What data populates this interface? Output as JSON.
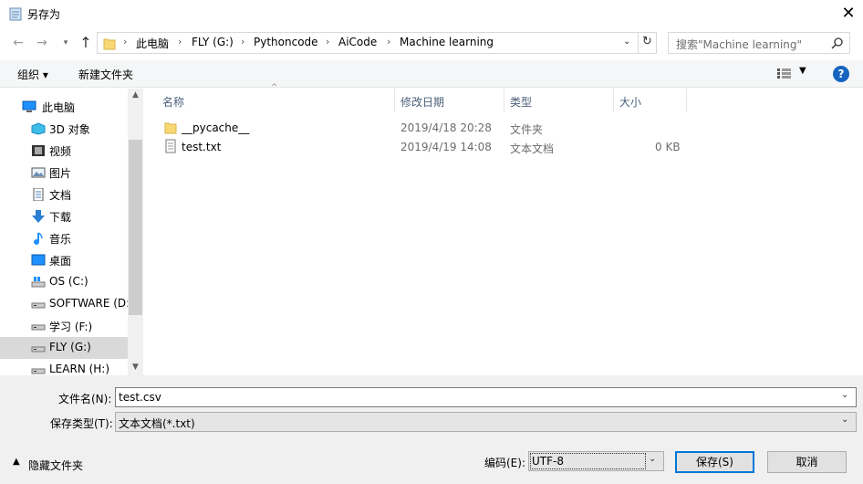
{
  "window": {
    "title": "另存为"
  },
  "nav": {
    "back": "←",
    "forward": "→",
    "up": "↑"
  },
  "address": {
    "root": "此电脑",
    "crumbs": [
      "FLY (G:)",
      "Pythoncode",
      "AiCode",
      "Machine learning"
    ]
  },
  "search": {
    "placeholder": "搜索\"Machine learning\""
  },
  "toolbar": {
    "organize": "组织 ▾",
    "new_folder": "新建文件夹"
  },
  "sidebar": {
    "items": [
      {
        "label": "此电脑",
        "icon": "computer-icon"
      },
      {
        "label": "3D 对象",
        "icon": "cube-3d-icon"
      },
      {
        "label": "视频",
        "icon": "video-icon"
      },
      {
        "label": "图片",
        "icon": "picture-icon"
      },
      {
        "label": "文档",
        "icon": "document-icon"
      },
      {
        "label": "下载",
        "icon": "download-icon"
      },
      {
        "label": "音乐",
        "icon": "music-icon"
      },
      {
        "label": "桌面",
        "icon": "desktop-icon"
      },
      {
        "label": "OS (C:)",
        "icon": "windows-drive-icon"
      },
      {
        "label": "SOFTWARE (D:",
        "icon": "drive-icon"
      },
      {
        "label": "学习 (F:)",
        "icon": "drive-icon"
      },
      {
        "label": "FLY (G:)",
        "icon": "drive-icon"
      },
      {
        "label": "LEARN (H:)",
        "icon": "drive-icon"
      }
    ]
  },
  "filelist": {
    "columns": [
      "名称",
      "修改日期",
      "类型",
      "大小"
    ],
    "rows": [
      {
        "name": "__pycache__",
        "date": "2019/4/18 20:28",
        "type": "文件夹",
        "size": "",
        "icon": "folder-icon"
      },
      {
        "name": "test.txt",
        "date": "2019/4/19 14:08",
        "type": "文本文档",
        "size": "0 KB",
        "icon": "text-file-icon"
      }
    ]
  },
  "form": {
    "filename_label": "文件名(N):",
    "filename_value": "test.csv",
    "filetype_label": "保存类型(T):",
    "filetype_value": "文本文档(*.txt)",
    "hide_folders": "隐藏文件夹",
    "encoding_label": "编码(E):",
    "encoding_value": "UTF-8",
    "save": "保存(S)",
    "cancel": "取消"
  },
  "colors": {
    "accent": "#0078d7",
    "folder": "#f8d775",
    "help": "#1565c0"
  }
}
